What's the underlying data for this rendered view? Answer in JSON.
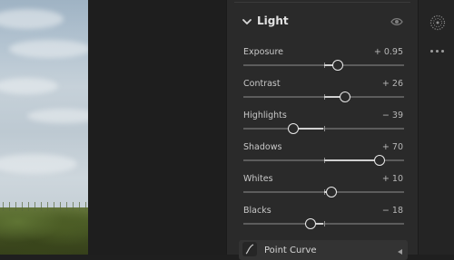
{
  "light_panel": {
    "title": "Light",
    "sliders": [
      {
        "label": "Exposure",
        "value": "+ 0.95",
        "position": 0.59
      },
      {
        "label": "Contrast",
        "value": "+ 26",
        "position": 0.63
      },
      {
        "label": "Highlights",
        "value": "− 39",
        "position": 0.31
      },
      {
        "label": "Shadows",
        "value": "+ 70",
        "position": 0.85
      },
      {
        "label": "Whites",
        "value": "+ 10",
        "position": 0.55
      },
      {
        "label": "Blacks",
        "value": "− 18",
        "position": 0.42
      }
    ]
  },
  "point_curve": {
    "title": "Point Curve"
  },
  "icons": {
    "collapse": "chevron-down-icon",
    "visibility": "eye-icon",
    "curve": "curve-icon",
    "masking": "masking-icon",
    "more": "more-icon"
  },
  "colors": {
    "panel_bg": "#2a2a2a",
    "track": "#5c5c5c",
    "track_fill": "#d0d0d0",
    "thumb_border": "#e9e9e9",
    "text": "#c9c9c9"
  }
}
